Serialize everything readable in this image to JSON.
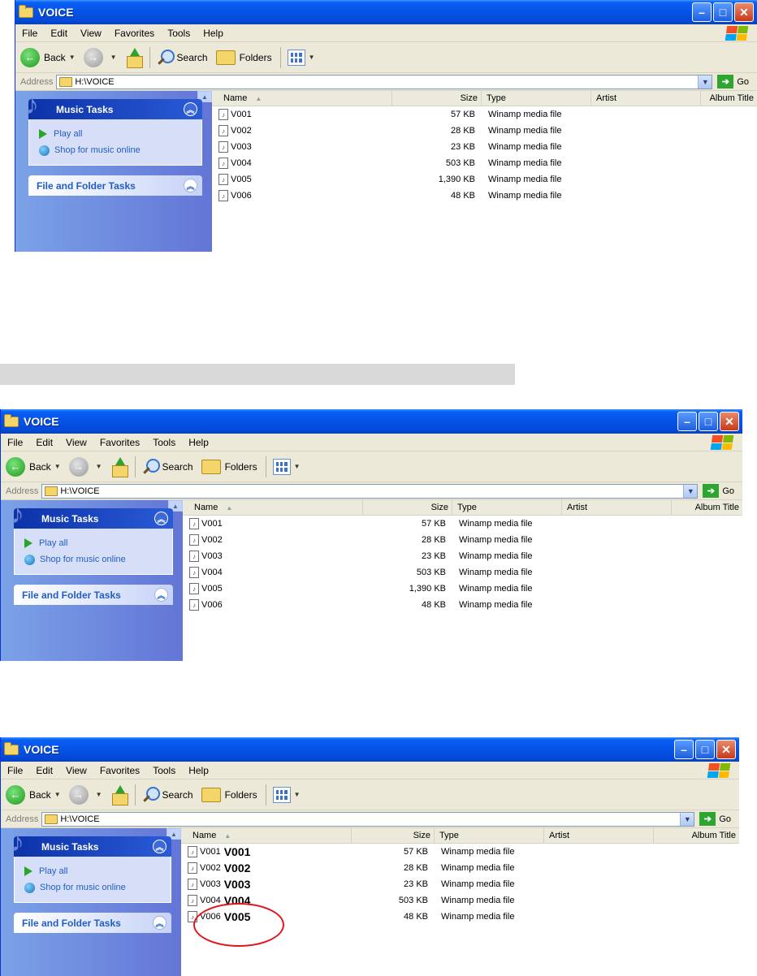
{
  "window": {
    "title": "VOICE",
    "menu": [
      "File",
      "Edit",
      "View",
      "Favorites",
      "Tools",
      "Help"
    ],
    "toolbar": {
      "back": "Back",
      "search": "Search",
      "folders": "Folders"
    },
    "address": {
      "label": "Address",
      "value": "H:\\VOICE",
      "go": "Go"
    },
    "sidebar": {
      "music_tasks": {
        "title": "Music Tasks",
        "items": [
          "Play all",
          "Shop for music online"
        ]
      },
      "file_folder_tasks": {
        "title": "File and Folder Tasks"
      }
    },
    "columns": [
      "Name",
      "Size",
      "Type",
      "Artist",
      "Album Title"
    ]
  },
  "screenshot1": {
    "files": [
      {
        "name": "V001",
        "size": "57 KB",
        "type": "Winamp media file"
      },
      {
        "name": "V002",
        "size": "28 KB",
        "type": "Winamp media file"
      },
      {
        "name": "V003",
        "size": "23 KB",
        "type": "Winamp media file"
      },
      {
        "name": "V004",
        "size": "503 KB",
        "type": "Winamp media file"
      },
      {
        "name": "V005",
        "size": "1,390 KB",
        "type": "Winamp media file"
      },
      {
        "name": "V006",
        "size": "48 KB",
        "type": "Winamp media file"
      }
    ]
  },
  "screenshot2": {
    "files": [
      {
        "name": "V001",
        "size": "57 KB",
        "type": "Winamp media file"
      },
      {
        "name": "V002",
        "size": "28 KB",
        "type": "Winamp media file"
      },
      {
        "name": "V003",
        "size": "23 KB",
        "type": "Winamp media file"
      },
      {
        "name": "V004",
        "size": "503 KB",
        "type": "Winamp media file"
      },
      {
        "name": "V005",
        "size": "1,390 KB",
        "type": "Winamp media file"
      },
      {
        "name": "V006",
        "size": "48 KB",
        "type": "Winamp media file"
      }
    ]
  },
  "screenshot3": {
    "files": [
      {
        "name": "V001",
        "label": "V001",
        "size": "57 KB",
        "type": "Winamp media file"
      },
      {
        "name": "V002",
        "label": "V002",
        "size": "28 KB",
        "type": "Winamp media file"
      },
      {
        "name": "V003",
        "label": "V003",
        "size": "23 KB",
        "type": "Winamp media file"
      },
      {
        "name": "V004",
        "label": "V004",
        "size": "503 KB",
        "type": "Winamp media file"
      },
      {
        "name": "V006",
        "label": "V005",
        "size": "48 KB",
        "type": "Winamp media file"
      }
    ]
  },
  "colors": {
    "annotation": "#e0161c",
    "titlebar": "#0553e6",
    "sidebar": "#7ba2e7"
  }
}
